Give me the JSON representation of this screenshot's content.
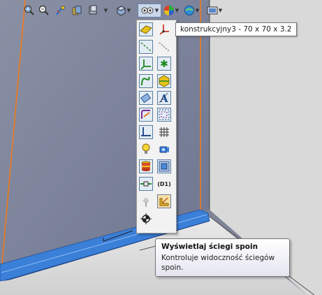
{
  "toolbar": {
    "items": [
      {
        "icon": "zoom-to-fit-icon"
      },
      {
        "icon": "zoom-to-area-icon"
      },
      {
        "icon": "previous-view-icon"
      },
      {
        "icon": "section-view-icon"
      },
      {
        "icon": "dynamic-annotation-icon"
      },
      {
        "icon": "view-orientation-icon"
      },
      {
        "icon": "hide-show-items-icon"
      },
      {
        "icon": "edit-appearance-icon"
      },
      {
        "icon": "apply-scene-icon"
      },
      {
        "icon": "view-settings-icon"
      }
    ]
  },
  "flyout": {
    "buttons": [
      {
        "icon": "view-planes-icon"
      },
      {
        "icon": "view-origins-icon"
      },
      {
        "icon": "view-axes-icon"
      },
      {
        "icon": "view-temporary-axes-icon"
      },
      {
        "icon": "view-coordinate-systems-icon"
      },
      {
        "icon": "view-points-icon"
      },
      {
        "icon": "view-curves-icon"
      },
      {
        "icon": "view-parting-lines-icon"
      },
      {
        "icon": "view-sketches-icon"
      },
      {
        "icon": "view-annotations-icon"
      },
      {
        "icon": "view-3d-sketch-planes-icon"
      },
      {
        "icon": "view-sketch-relations-icon"
      },
      {
        "icon": "view-dimension-names-icon"
      },
      {
        "icon": "view-grid-icon"
      },
      {
        "icon": "view-lights-icon"
      },
      {
        "icon": "view-cameras-icon"
      },
      {
        "icon": "view-decals-icon"
      },
      {
        "icon": "view-bounding-box-icon"
      },
      {
        "icon": "view-weld-routing-icon"
      },
      {
        "icon": "view-dimension-labels-icon",
        "label": "(D1)"
      },
      {
        "icon": "view-weld-symbols-icon"
      },
      {
        "icon": "view-weld-beads-icon"
      },
      {
        "icon": "view-center-of-mass-icon"
      }
    ]
  },
  "tooltip_part": {
    "text": "konstrukcyjny3 - 70 x 70 x 3.2"
  },
  "tooltip_weld": {
    "title": "Wyświetlaj ściegi spoin",
    "description": "Kontroluje widoczność ściegów spoin."
  },
  "colors": {
    "viewport_background": "#7f8597",
    "wall": "#6f7790",
    "floor": "#e1e1e1",
    "wall_right": "#d6d6d6",
    "edge_highlight": "#f07a1a",
    "weld_bead": "#3a7fd8"
  }
}
